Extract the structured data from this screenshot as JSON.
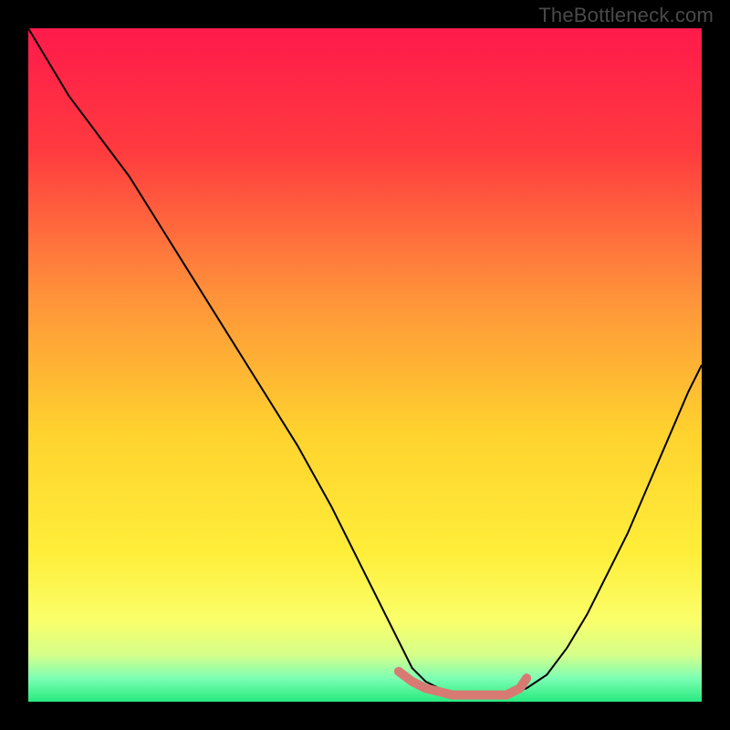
{
  "watermark": "TheBottleneck.com",
  "chart_data": {
    "type": "line",
    "title": "",
    "xlabel": "",
    "ylabel": "",
    "xlim": [
      0,
      100
    ],
    "ylim": [
      0,
      100
    ],
    "grid": false,
    "legend": false,
    "background_gradient_stops": [
      {
        "offset": 0.0,
        "color": "#ff1a4b"
      },
      {
        "offset": 0.18,
        "color": "#ff3a3f"
      },
      {
        "offset": 0.4,
        "color": "#ff933a"
      },
      {
        "offset": 0.6,
        "color": "#ffd22e"
      },
      {
        "offset": 0.78,
        "color": "#ffee3a"
      },
      {
        "offset": 0.88,
        "color": "#faff6a"
      },
      {
        "offset": 0.93,
        "color": "#d6ff8a"
      },
      {
        "offset": 0.965,
        "color": "#7dffb4"
      },
      {
        "offset": 1.0,
        "color": "#27e97e"
      }
    ],
    "series": [
      {
        "name": "bottleneck-curve",
        "stroke": "#000000",
        "stroke_width": 2,
        "x": [
          0,
          3,
          6,
          9,
          12,
          15,
          20,
          25,
          30,
          35,
          40,
          45,
          50,
          55,
          57,
          59,
          61,
          63,
          65,
          68,
          71,
          74,
          77,
          80,
          83,
          86,
          89,
          92,
          95,
          98,
          100
        ],
        "y": [
          100,
          95,
          90,
          86,
          82,
          78,
          70,
          62,
          54,
          46,
          38,
          29,
          19,
          9,
          5,
          3,
          2,
          1,
          1,
          1,
          1,
          2,
          4,
          8,
          13,
          19,
          25,
          32,
          39,
          46,
          50
        ]
      },
      {
        "name": "optimal-band",
        "stroke": "#d87a74",
        "stroke_width": 10,
        "linecap": "round",
        "x": [
          55,
          57,
          59,
          61,
          63,
          65,
          67,
          69,
          71,
          73,
          74
        ],
        "y": [
          4.5,
          3,
          2,
          1.5,
          1,
          1,
          1,
          1,
          1,
          2,
          3.5
        ]
      }
    ]
  }
}
